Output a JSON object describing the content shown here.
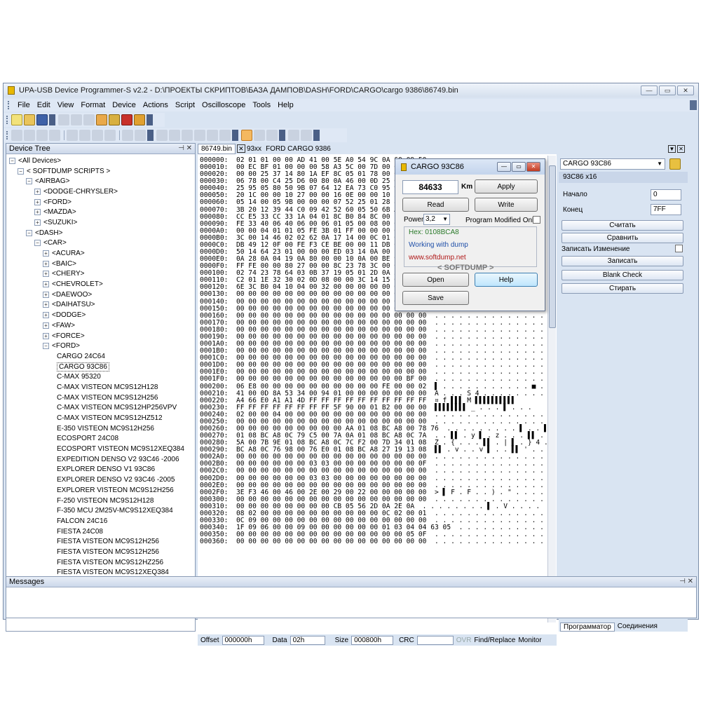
{
  "window": {
    "title": "UPA-USB Device Programmer-S v2.2 - D:\\ПРОЕКТЫ СКРИПТОВ\\БАЗА ДАМПОВ\\DASH\\FORD\\CARGO\\cargo 9386\\86749.bin",
    "controls": [
      "—",
      "▭",
      "✕"
    ]
  },
  "menu": [
    "File",
    "Edit",
    "View",
    "Format",
    "Device",
    "Actions",
    "Script",
    "Oscilloscope",
    "Tools",
    "Help"
  ],
  "device_tree": {
    "header": "Device Tree",
    "header_icons": "⊣ ✕",
    "nodes": [
      {
        "label": "<All Devices>",
        "level": 0,
        "exp": "⊟"
      },
      {
        "label": "< SOFTDUMP SCRIPTS >",
        "level": 1,
        "exp": "⊟"
      },
      {
        "label": "<AIRBAG>",
        "level": 2,
        "exp": "⊟"
      },
      {
        "label": "<DODGE-CHRYSLER>",
        "level": 3,
        "exp": "⊞"
      },
      {
        "label": "<FORD>",
        "level": 3,
        "exp": "⊞"
      },
      {
        "label": "<MAZDA>",
        "level": 3,
        "exp": "⊞"
      },
      {
        "label": "<SUZUKI>",
        "level": 3,
        "exp": "⊞"
      },
      {
        "label": "<DASH>",
        "level": 2,
        "exp": "⊟"
      },
      {
        "label": "<CAR>",
        "level": 3,
        "exp": "⊟"
      },
      {
        "label": "<ACURA>",
        "level": 4,
        "exp": "⊞"
      },
      {
        "label": "<BAIC>",
        "level": 4,
        "exp": "⊞"
      },
      {
        "label": "<CHERY>",
        "level": 4,
        "exp": "⊞"
      },
      {
        "label": "<CHEVROLET>",
        "level": 4,
        "exp": "⊞"
      },
      {
        "label": "<DAEWOO>",
        "level": 4,
        "exp": "⊞"
      },
      {
        "label": "<DAIHATSU>",
        "level": 4,
        "exp": "⊞"
      },
      {
        "label": "<DODGE>",
        "level": 4,
        "exp": "⊞"
      },
      {
        "label": "<FAW>",
        "level": 4,
        "exp": "⊞"
      },
      {
        "label": "<FORCE>",
        "level": 4,
        "exp": "⊞"
      },
      {
        "label": "<FORD>",
        "level": 4,
        "exp": "⊟"
      },
      {
        "label": "CARGO 24C64",
        "level": 5,
        "exp": ""
      },
      {
        "label": "CARGO 93C86",
        "level": 5,
        "exp": "",
        "selected": true
      },
      {
        "label": "C-MAX 95320",
        "level": 5,
        "exp": ""
      },
      {
        "label": "C-MAX VISTEON MC9S12H128",
        "level": 5,
        "exp": ""
      },
      {
        "label": "C-MAX VISTEON MC9S12H256",
        "level": 5,
        "exp": ""
      },
      {
        "label": "C-MAX VISTEON MC9S12HP256VPV",
        "level": 5,
        "exp": ""
      },
      {
        "label": "C-MAX VISTEON MC9S12HZ512",
        "level": 5,
        "exp": ""
      },
      {
        "label": "E-350 VISTEON  MC9S12H256",
        "level": 5,
        "exp": ""
      },
      {
        "label": "ECOSPORT 24C08",
        "level": 5,
        "exp": ""
      },
      {
        "label": "ECOSPORT VISTEON MC9S12XEQ384",
        "level": 5,
        "exp": ""
      },
      {
        "label": "EXPEDITION DENSO V2 93C46 -2006",
        "level": 5,
        "exp": ""
      },
      {
        "label": "EXPLORER DENSO V1 93C86",
        "level": 5,
        "exp": ""
      },
      {
        "label": "EXPLORER DENSO V2 93C46 -2005",
        "level": 5,
        "exp": ""
      },
      {
        "label": "EXPLORER VISTEON MC9S12H256",
        "level": 5,
        "exp": ""
      },
      {
        "label": "F-250 VISTEON MC9S12H128",
        "level": 5,
        "exp": ""
      },
      {
        "label": "F-350 MCU 2M25V-MC9S12XEQ384",
        "level": 5,
        "exp": ""
      },
      {
        "label": "FALCON 24C16",
        "level": 5,
        "exp": ""
      },
      {
        "label": "FIESTA 24C08",
        "level": 5,
        "exp": ""
      },
      {
        "label": "FIESTA VISTEON  MC9S12H256",
        "level": 5,
        "exp": ""
      },
      {
        "label": "FIESTA VISTEON  MC9S12H256",
        "level": 5,
        "exp": ""
      },
      {
        "label": "FIESTA VISTEON  MC9S12HZ256",
        "level": 5,
        "exp": ""
      },
      {
        "label": "FIESTA VISTEON  MC9S12XEQ384",
        "level": 5,
        "exp": ""
      }
    ]
  },
  "editor": {
    "tabs": [
      {
        "label": "86749.bin",
        "active": true
      },
      {
        "label": "✕",
        "active": false
      },
      {
        "label": "93xx",
        "active": false
      },
      {
        "label": "FORD CARGO 9386",
        "active": false
      }
    ],
    "hex_rows": [
      "000000:  02 01 01 00 00 AD 41 00 5E A0 54 9C 0A 60 09 50",
      "000010:  00 EC BF 01 00 00 00 58 A3 5C 00 7D 00 03 15 02",
      "000020:  00 00 25 37 14 80 1A EF 8C 05 01 78 00 03 00 00",
      "000030:  06 78 00 C4 25 D6 00 80 0A 46 00 0D 25 01 00 00",
      "000040:  25 95 05 80 50 9B 07 64 12 EA 73 C0 95 93 C0 12",
      "000050:  20 1C 00 00 10 27 00 00 16 0E 00 00 10 27 32 19",
      "000060:  05 14 00 05 9B 00 00 00 07 52 25 01 28 80 1C 26",
      "000070:  3B 20 12 39 44 C0 09 42 52 60 05 50 6B A0 FF 66",
      "000080:  CC E5 33 CC 33 1A 04 01 8C B0 84 8C 00 10 40 06",
      "000090:  FE 33 40 06 40 06 00 06 01 05 00 08 00 0A 00 00",
      "0000A0:  00 00 04 01 01 05 FE 3B 01 FF 00 00 00 0A 00 03",
      "0000B0:  3C 00 14 46 02 02 62 0A 17 14 00 0C 01 01 01 00",
      "0000C0:  DB 49 12 0F 00 FE F3 CE BE 00 00 11 DB 68 FF 95",
      "0000D0:  50 14 64 23 01 00 00 00 ED 03 14 0A 00 14 28 1E",
      "0000E0:  0A 28 0A 04 19 0A 80 00 00 10 0A 00 BE 94 AB 22",
      "0000F0:  FF FE 00 00 80 27 00 00 8C 23 78 3C 00 02 00 78",
      "000100:  02 74 23 78 64 03 0B 37 19 05 01 2D 0A 3C 64 00",
      "000110:  C2 01 1E 32 30 02 0D 08 00 00 3C 14 15 02 15 02",
      "000120:  6E 3C B0 04 10 04 00 32 00 00 00 00 00 00 00 00",
      "000130:  00 00 00 00 00 00 00 00 00 00 00 00 00 00 00 00",
      "000140:  00 00 00 00 00 00 00 00 00 00 00 00 00 00 00 00  . . . . . . . . . . . . . . . .",
      "000150:  00 00 00 00 00 00 00 00 00 00 00 00 00 00 00 00  . . . . . . . . . . . . . . . .",
      "000160:  00 00 00 00 00 00 00 00 00 00 00 00 00 00 00 00  . . . . . . . . . . . . . . . .",
      "000170:  00 00 00 00 00 00 00 00 00 00 00 00 00 00 00 00  . . . . . . . . . . . . . . . .",
      "000180:  00 00 00 00 00 00 00 00 00 00 00 00 00 00 00 00  . . . . . . . . . . . . . . . .",
      "000190:  00 00 00 00 00 00 00 00 00 00 00 00 00 00 00 00  . . . . . . . . . . . . . . . .",
      "0001A0:  00 00 00 00 00 00 00 00 00 00 00 00 00 00 00 00  . . . . . . . . . . . . . . . .",
      "0001B0:  00 00 00 00 00 00 00 00 00 00 00 00 00 00 00 00  . . . . . . . . . . . . . . . .",
      "0001C0:  00 00 00 00 00 00 00 00 00 00 00 00 00 00 00 00  . . . . . . . . . . . . . . . .",
      "0001D0:  00 00 00 00 00 00 00 00 00 00 00 00 00 00 00 00  . . . . . . . . . . . . . . . .",
      "0001E0:  00 00 00 00 00 00 00 00 00 00 00 00 00 00 00 00  . . . . . . . . . . . . . . . .",
      "0001F0:  00 00 00 00 00 00 00 00 00 00 00 00 00 00 BF 00  . . . . . . . . . . . . . . ┐ .",
      "000200:  06 E8 00 00 00 00 00 00 00 00 00 00 FE 00 00 02  ▌ . . . . . . . . . . . ■ . . .",
      "000210:  41 00 0D 8A 53 34 00 94 01 00 00 00 00 00 00 00  A . . . S 4 . . . . . . . . . .",
      "000220:  A4 66 E0 A1 A1 4D FF FF FF FF FF FF FF FF FF FF  ¤ f ▌▌▌ M ▌▌▌▌▌▌▌▌▌▌",
      "000230:  FF FF FF FF FF FF FF FF 5F 90 00 01 B2 00 00 00  ▌▌▌▌▌▌▌▌ _ . . . ▌ . . .",
      "000240:  02 00 00 04 00 00 00 00 00 00 00 00 00 00 00 00  . . . . . . . . . . . . . . . .",
      "000250:  00 00 00 00 00 00 00 00 00 00 00 00 00 00 00 00  . . . . . . . . . . . . . . . .",
      "000260:  00 00 00 00 00 00 00 00 00 AA 01 08 BC A8 00 78 76  . . . . . . . . . ▌ . . ▌▌ . x v",
      "000270:  01 08 BC A8 0C 79 C5 00 7A 0A 01 08 BC A8 0C 7A  . . ▌▌ . y ▌ . z . . . ▌▌ . z",
      "000280:  5A 00 7B 9E 01 08 BC A8 0C 7C F2 00 7D 34 01 08  Z . { . . . ▌▌ . | ▌ . } 4 . .",
      "000290:  BC A8 0C 76 98 00 76 E0 01 08 BC A8 27 19 13 08  ▌▌ . v . . v ▌ . . ▌▌ ' . . .",
      "0002A0:  00 00 00 00 00 00 00 00 00 00 00 00 00 00 00 00  . . . . . . . . . . . . . . . .",
      "0002B0:  00 00 00 00 00 00 03 03 00 00 00 00 00 00 00 0F  . . . . . . . . . . . . . . . .",
      "0002C0:  00 00 00 00 00 00 00 00 00 00 00 00 00 00 00 00  . . . . . . . . . . . . . . . .",
      "0002D0:  00 00 00 00 00 00 03 03 00 00 00 00 00 00 00 00  . . . . . . . . . . . . . . . .",
      "0002E0:  00 00 00 00 00 00 00 00 00 00 00 00 00 00 00 00  . . . . . . . . . . . . . . . .",
      "0002F0:  3E F3 46 00 46 00 2E 00 29 00 22 00 00 00 00 00  > ▌ F . F . . ) . \" . . . . .",
      "000300:  00 00 00 00 00 00 00 00 00 00 00 00 00 00 00 00  . . . . . . . . . . . . . . . .",
      "000310:  00 00 00 00 00 00 00 00 CB 05 56 2D 0A 2E 0A  . . . . . . . . ▌ . V . . . .",
      "000320:  08 02 00 00 00 00 00 00 00 00 00 00 0C 02 00 01  . . . . . . . . . . . . . . . .",
      "000330:  0C 09 00 00 00 00 00 00 00 00 00 00 00 00 00 00  . . . . . . . . . . . . . . . .",
      "000340:  1F 09 06 00 00 09 00 00 00 00 00 00 01 03 04 04 63 05  . . . . . . . . . . . . c .",
      "000350:  00 00 00 00 00 00 00 00 00 00 00 00 00 00 05 0F  . . . . . . . . . . . . . . . .",
      "000360:  00 00 00 00 00 00 00 00 00 00 00 00 00 00 00 00  . . . . . . . . . . . . . . . ."
    ],
    "status": {
      "offset_label": "Offset",
      "offset_value": "000000h",
      "data_label": "Data",
      "data_value": "02h",
      "size_label": "Size",
      "size_value": "000800h",
      "crc_label": "CRC",
      "ovr": "OVR",
      "find_replace": "Find/Replace",
      "monitor": "Monitor"
    }
  },
  "dialog": {
    "title": "CARGO 93C86",
    "km_value": "84633",
    "km_unit": "Km",
    "apply": "Apply",
    "read": "Read",
    "write": "Write",
    "power_label": "Power",
    "power_value": "3,2",
    "program_modified": "Program Modified Only",
    "hex_text": "Hex: 0108BCA8",
    "working_text": "Working with dump",
    "url": "www.softdump.net",
    "brand": "< SOFTDUMP >",
    "open": "Open",
    "help": "Help",
    "save": "Save"
  },
  "right_panel": {
    "device_select": "CARGO 93C86",
    "chip_info": "93C86 x16",
    "start_label": "Начало",
    "start_value": "0",
    "end_label": "Конец",
    "end_value": "7FF",
    "btn_read": "Считать",
    "btn_compare": "Сравнить",
    "write_change_label": "Записать Изменение",
    "btn_write": "Записать",
    "btn_blank": "Blank Check",
    "btn_erase": "Стирать",
    "tab_programmer": "Программатор",
    "tab_connections": "Соединения"
  },
  "messages": {
    "header": "Messages",
    "header_icons": "⊣ ✕"
  },
  "colors": {
    "chrome": "#d9e4f2",
    "hex_green": "#2a7a2a",
    "hex_blue": "#1f4fa8",
    "hex_red": "#b01818"
  }
}
